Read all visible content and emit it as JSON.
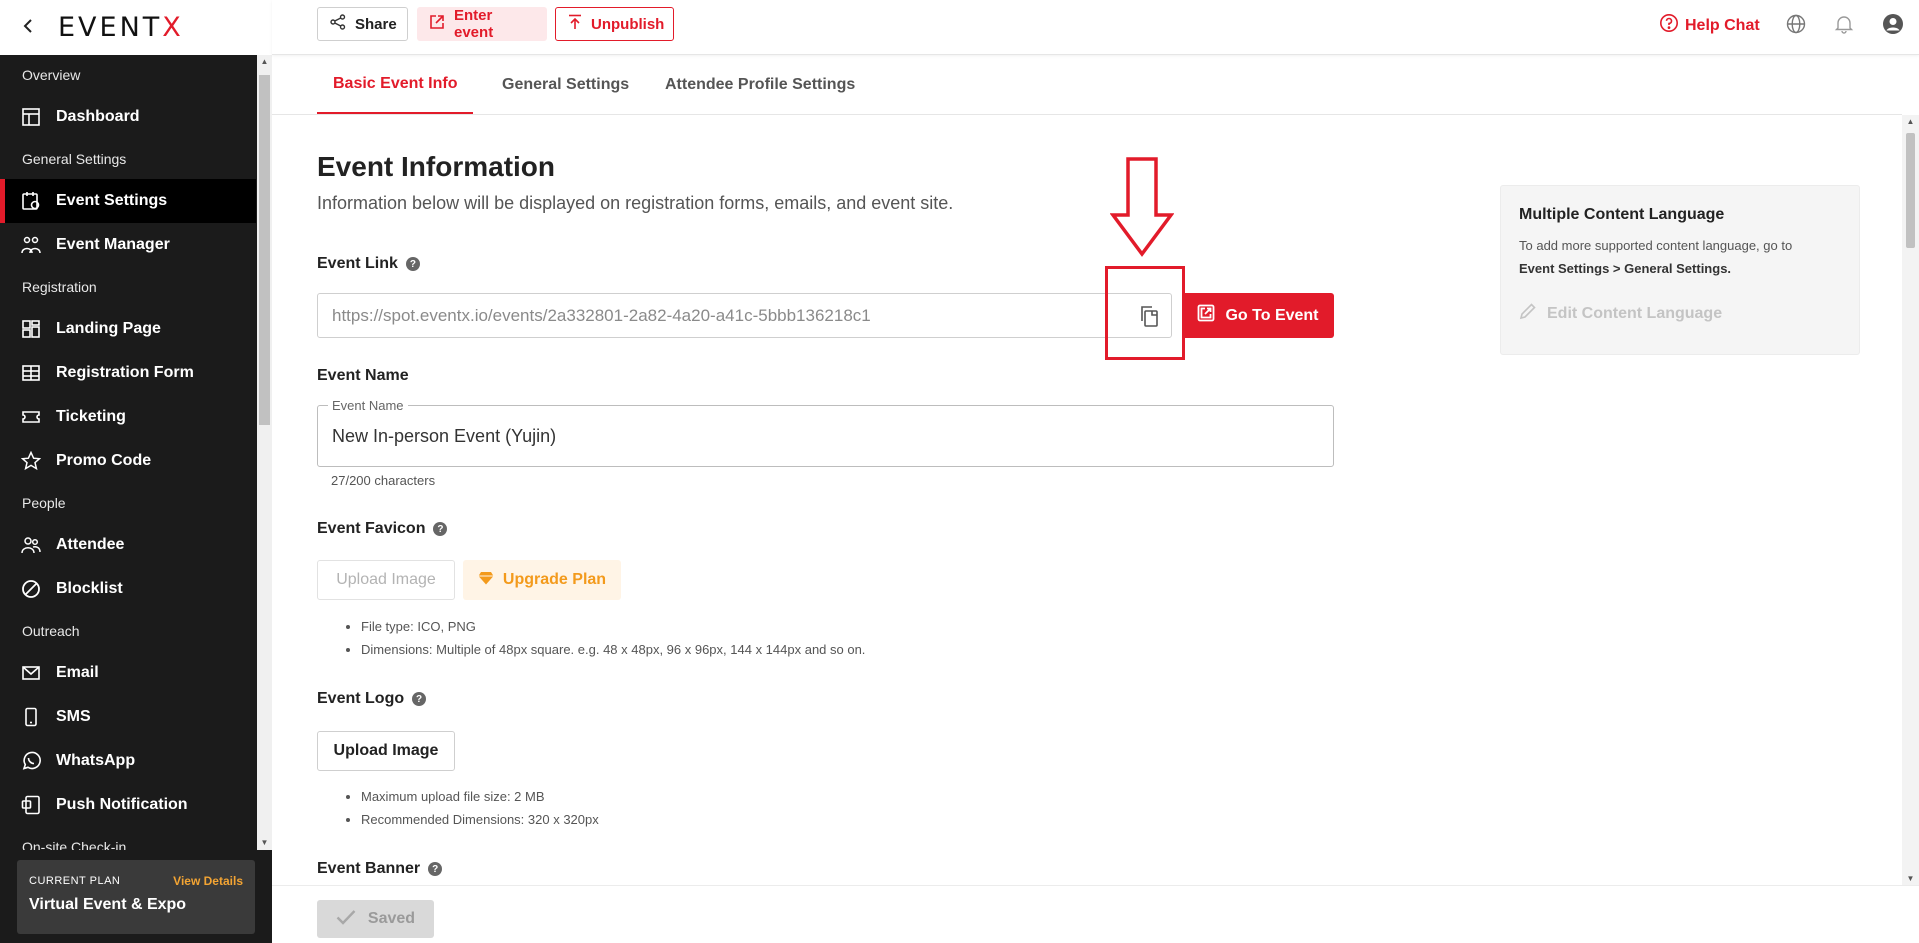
{
  "brand": {
    "logo_prefix": "EVENT",
    "logo_x": "X",
    "back_icon": "chevron-left-icon"
  },
  "topbar": {
    "share_label": "Share",
    "enter_label": "Enter event",
    "unpublish_label": "Unpublish",
    "help_label": "Help Chat"
  },
  "sidebar": {
    "sections": [
      {
        "label": "Overview",
        "items": [
          {
            "label": "Dashboard",
            "icon": "dashboard-icon"
          }
        ]
      },
      {
        "label": "General Settings",
        "items": [
          {
            "label": "Event Settings",
            "icon": "event-settings-icon",
            "active": true
          },
          {
            "label": "Event Manager",
            "icon": "team-icon"
          }
        ]
      },
      {
        "label": "Registration",
        "items": [
          {
            "label": "Landing Page",
            "icon": "layout-icon"
          },
          {
            "label": "Registration Form",
            "icon": "table-icon"
          },
          {
            "label": "Ticketing",
            "icon": "ticket-icon"
          },
          {
            "label": "Promo Code",
            "icon": "star-icon"
          }
        ]
      },
      {
        "label": "People",
        "items": [
          {
            "label": "Attendee",
            "icon": "people-icon"
          },
          {
            "label": "Blocklist",
            "icon": "block-icon"
          }
        ]
      },
      {
        "label": "Outreach",
        "items": [
          {
            "label": "Email",
            "icon": "mail-icon"
          },
          {
            "label": "SMS",
            "icon": "phone-icon"
          },
          {
            "label": "WhatsApp",
            "icon": "whatsapp-icon"
          },
          {
            "label": "Push Notification",
            "icon": "notification-icon"
          }
        ]
      },
      {
        "label": "On-site Check-in",
        "items": []
      }
    ],
    "plan": {
      "label": "CURRENT PLAN",
      "link": "View Details",
      "name": "Virtual Event & Expo"
    }
  },
  "tabs": [
    {
      "label": "Basic Event Info",
      "active": true
    },
    {
      "label": "General Settings",
      "active": false
    },
    {
      "label": "Attendee Profile Settings",
      "active": false
    }
  ],
  "main": {
    "title": "Event Information",
    "subtitle": "Information below will be displayed on registration forms, emails, and event site.",
    "event_link": {
      "label": "Event Link",
      "value": "https://spot.eventx.io/events/2a332801-2a82-4a20-a41c-5bbb136218c1",
      "goto_label": "Go To Event"
    },
    "event_name": {
      "label": "Event Name",
      "legend": "Event Name",
      "value": "New In-person Event (Yujin)",
      "counter": "27/200 characters"
    },
    "favicon": {
      "label": "Event Favicon",
      "upload_label": "Upload Image",
      "upgrade_label": "Upgrade Plan",
      "notes": [
        "File type: ICO, PNG",
        "Dimensions: Multiple of 48px square. e.g. 48 x 48px, 96 x 96px, 144 x 144px and so on."
      ]
    },
    "logo": {
      "label": "Event Logo",
      "upload_label": "Upload Image",
      "notes": [
        "Maximum upload file size: 2 MB",
        "Recommended Dimensions: 320 x 320px"
      ]
    },
    "banner": {
      "label": "Event Banner"
    }
  },
  "side_card": {
    "title": "Multiple Content Language",
    "text_line1": "To add more supported content language, go to",
    "text_line2": "Event Settings > General Settings.",
    "edit_label": "Edit Content Language"
  },
  "footer": {
    "saved_label": "Saved"
  },
  "colors": {
    "accent": "#e21b2a",
    "sidebar_bg": "#1b1b1b",
    "upgrade": "#f39a1c"
  }
}
